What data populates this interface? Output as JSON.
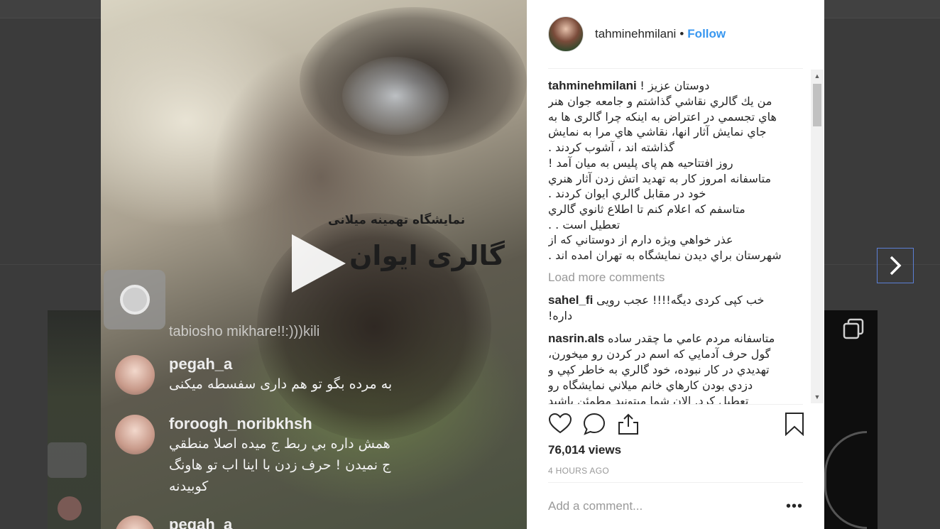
{
  "post": {
    "username": "tahminehmilani",
    "separator": "•",
    "follow_label": "Follow"
  },
  "media": {
    "overlay_small": "نمایشگاه تهمینه میلانی",
    "overlay_big": "گالری ایوان",
    "live_handle_partial": "tabiosho mikhare!!:)))kili",
    "live_comments": [
      {
        "user": "pegah_a",
        "message": "به مرده بگو تو هم داری سفسطه میکنی"
      },
      {
        "user": "foroogh_noribkhsh",
        "lines": [
          "همش داره بي ربط ج ميده اصلا منطقي",
          "ج نميدن ! حرف زدن با اينا اب تو هاونگ",
          "کوبيدنه"
        ]
      },
      {
        "user": "pegah_a"
      }
    ]
  },
  "caption": {
    "user": "tahminehmilani",
    "first": "دوستان عزيز !",
    "lines": [
      "من يك گالري نقاشي گذاشتم و جامعه جوان هنر",
      "هاي تجسمي در اعتراض به اينكه چرا گالری ها به",
      "جاي نمايش آثار انها، نقاشي هاي مرا به نمايش",
      "گذاشته اند ، آشوب كردند .",
      "روز افتتاحيه هم پای پليس به ميان آمد !",
      "متاسفانه امروز كار به تهديد اتش زدن آثار هنري",
      "خود در مقابل گالري ايوان كردند .",
      "متاسفم كه اعلام كنم تا اطلاع ثانوي گالري",
      "تعطيل است . .",
      "عذر خواهي ويژه دارم از دوستاني كه از",
      "شهرستان براي ديدن نمايشگاه به تهران امده اند ."
    ]
  },
  "load_more_label": "Load more comments",
  "comments": [
    {
      "user": "sahel_fi",
      "first": "خب کپی کردی دیگه!!!! عجب رویی",
      "lines": [
        "داره!"
      ]
    },
    {
      "user": "nasrin.als",
      "first": "متاسفانه مردم عامي ما چقدر ساده",
      "lines": [
        "گول حرف آدمايي كه اسم در كردن رو ميخورن،",
        "تهديدي در كار نبوده، خود گالري به خاطر كپي و",
        "دزدي بودن كارهاي خانم ميلاني نمايشگاه رو",
        "تعطيل كرد. الان شما ميتونيد مطمئن باشيد"
      ]
    }
  ],
  "stats": {
    "views": "76,014 views",
    "time": "4 HOURS AGO"
  },
  "add_comment": {
    "placeholder": "Add a comment...",
    "more_label": "•••"
  },
  "colors": {
    "accent": "#3897f0",
    "text": "#262626",
    "muted": "#999999",
    "overlay": "#3b3b3b",
    "next_border": "#5b7fd6"
  }
}
